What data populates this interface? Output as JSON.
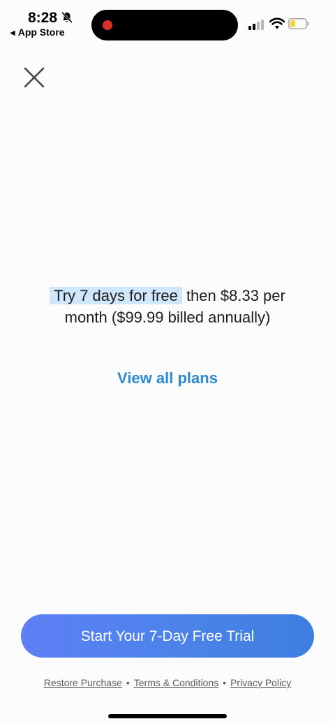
{
  "status_bar": {
    "time": "8:28",
    "back_app_label": "App Store",
    "icons": [
      "bell-slash-icon",
      "cellular-signal-icon",
      "wifi-icon",
      "battery-icon"
    ],
    "recording_color": "#d8342b",
    "battery_color": "#f5d33b"
  },
  "close_icon": "close-icon",
  "offer": {
    "highlight": "Try 7 days for free",
    "rest": " then $8.33 per month ($99.99 billed annually)",
    "highlight_color": "#cfe6fb"
  },
  "view_plans_label": "View all plans",
  "cta": {
    "label": "Start Your 7-Day Free Trial",
    "gradient_start": "#5e7ff5",
    "gradient_end": "#3e7ee0"
  },
  "footer": {
    "restore": "Restore Purchase",
    "separator": "•",
    "terms": "Terms & Conditions",
    "privacy": "Privacy Policy"
  },
  "accent_color": "#2b8bd1"
}
